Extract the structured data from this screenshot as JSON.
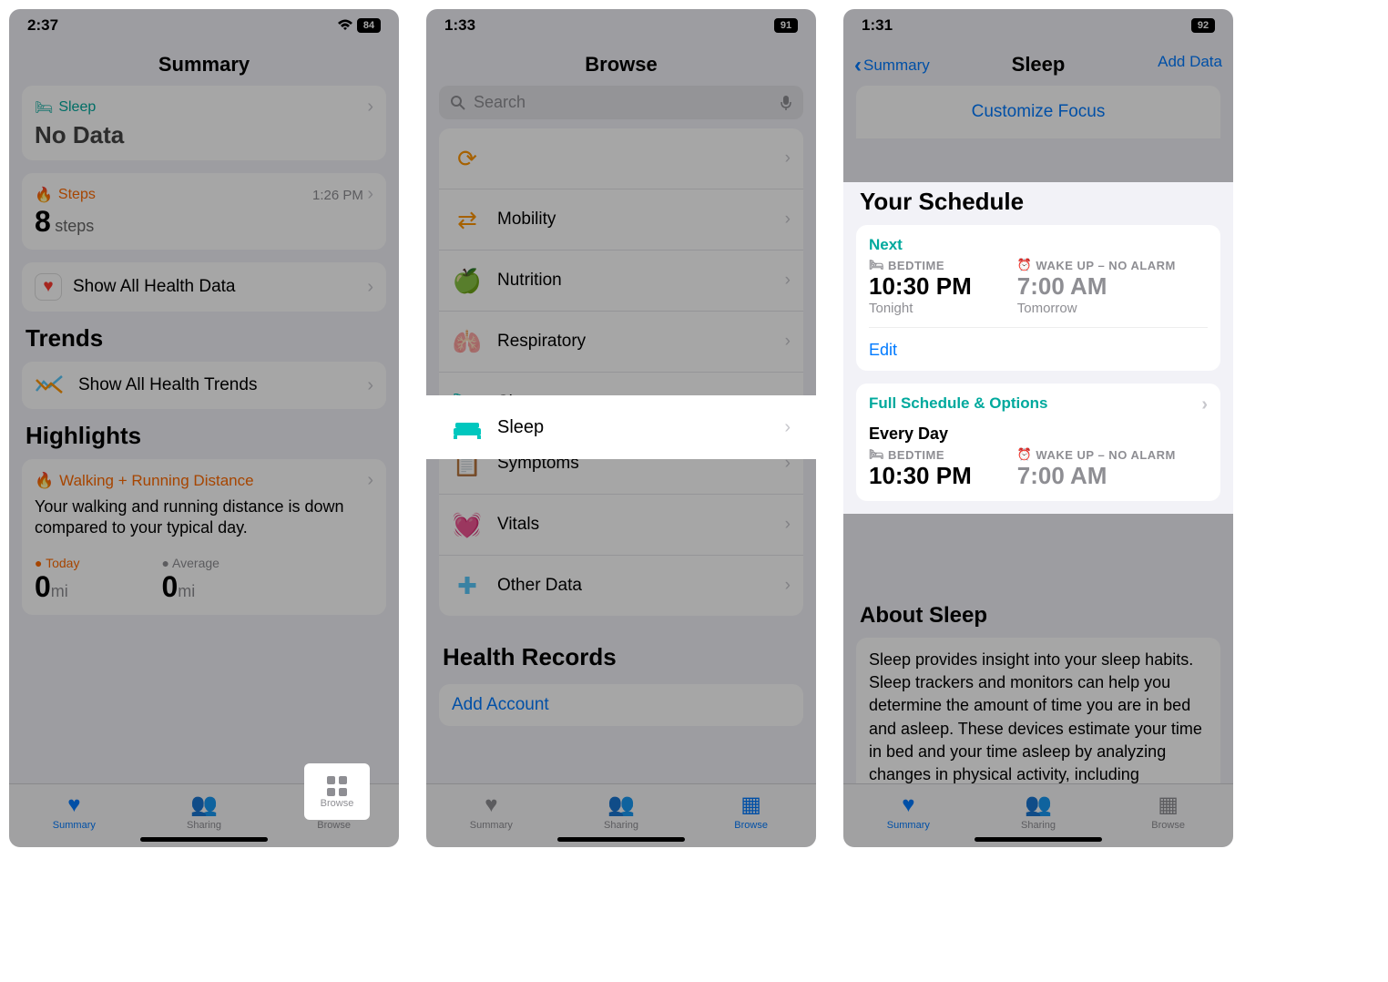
{
  "screen1": {
    "time": "2:37",
    "battery": "84",
    "title": "Summary",
    "sleep": {
      "label": "Sleep",
      "nodata": "No Data"
    },
    "steps": {
      "label": "Steps",
      "time": "1:26 PM",
      "value": "8",
      "unit": "steps"
    },
    "show_all": "Show All Health Data",
    "trends_title": "Trends",
    "trends_row": "Show All Health Trends",
    "highlights_title": "Highlights",
    "highlight": {
      "title": "Walking + Running Distance",
      "text": "Your walking and running distance is down compared to your typical day.",
      "today_label": "Today",
      "avg_label": "Average",
      "today_val": "0",
      "avg_val": "0",
      "unit": "mi"
    },
    "tabs": {
      "summary": "Summary",
      "sharing": "Sharing",
      "browse": "Browse"
    }
  },
  "screen2": {
    "time": "1:33",
    "battery": "91",
    "title": "Browse",
    "search_placeholder": "Search",
    "categories": {
      "mobility": "Mobility",
      "nutrition": "Nutrition",
      "respiratory": "Respiratory",
      "sleep": "Sleep",
      "symptoms": "Symptoms",
      "vitals": "Vitals",
      "other": "Other Data"
    },
    "health_records": "Health Records",
    "add_account": "Add Account",
    "tabs": {
      "summary": "Summary",
      "sharing": "Sharing",
      "browse": "Browse"
    }
  },
  "screen3": {
    "time": "1:31",
    "battery": "92",
    "back": "Summary",
    "title": "Sleep",
    "add_data": "Add Data",
    "customize_focus": "Customize Focus",
    "your_schedule": "Your Schedule",
    "next": "Next",
    "bedtime_label": "BEDTIME",
    "wakeup_label": "WAKE UP – NO ALARM",
    "bedtime": "10:30 PM",
    "wakeup": "7:00 AM",
    "tonight": "Tonight",
    "tomorrow": "Tomorrow",
    "edit": "Edit",
    "full_schedule": "Full Schedule & Options",
    "every_day": "Every Day",
    "about_title": "About Sleep",
    "about_text": "Sleep provides insight into your sleep habits. Sleep trackers and monitors can help you determine the amount of time you are in bed and asleep. These devices estimate your time in bed and your time asleep by analyzing changes in physical activity, including movement",
    "tabs": {
      "summary": "Summary",
      "sharing": "Sharing",
      "browse": "Browse"
    }
  }
}
